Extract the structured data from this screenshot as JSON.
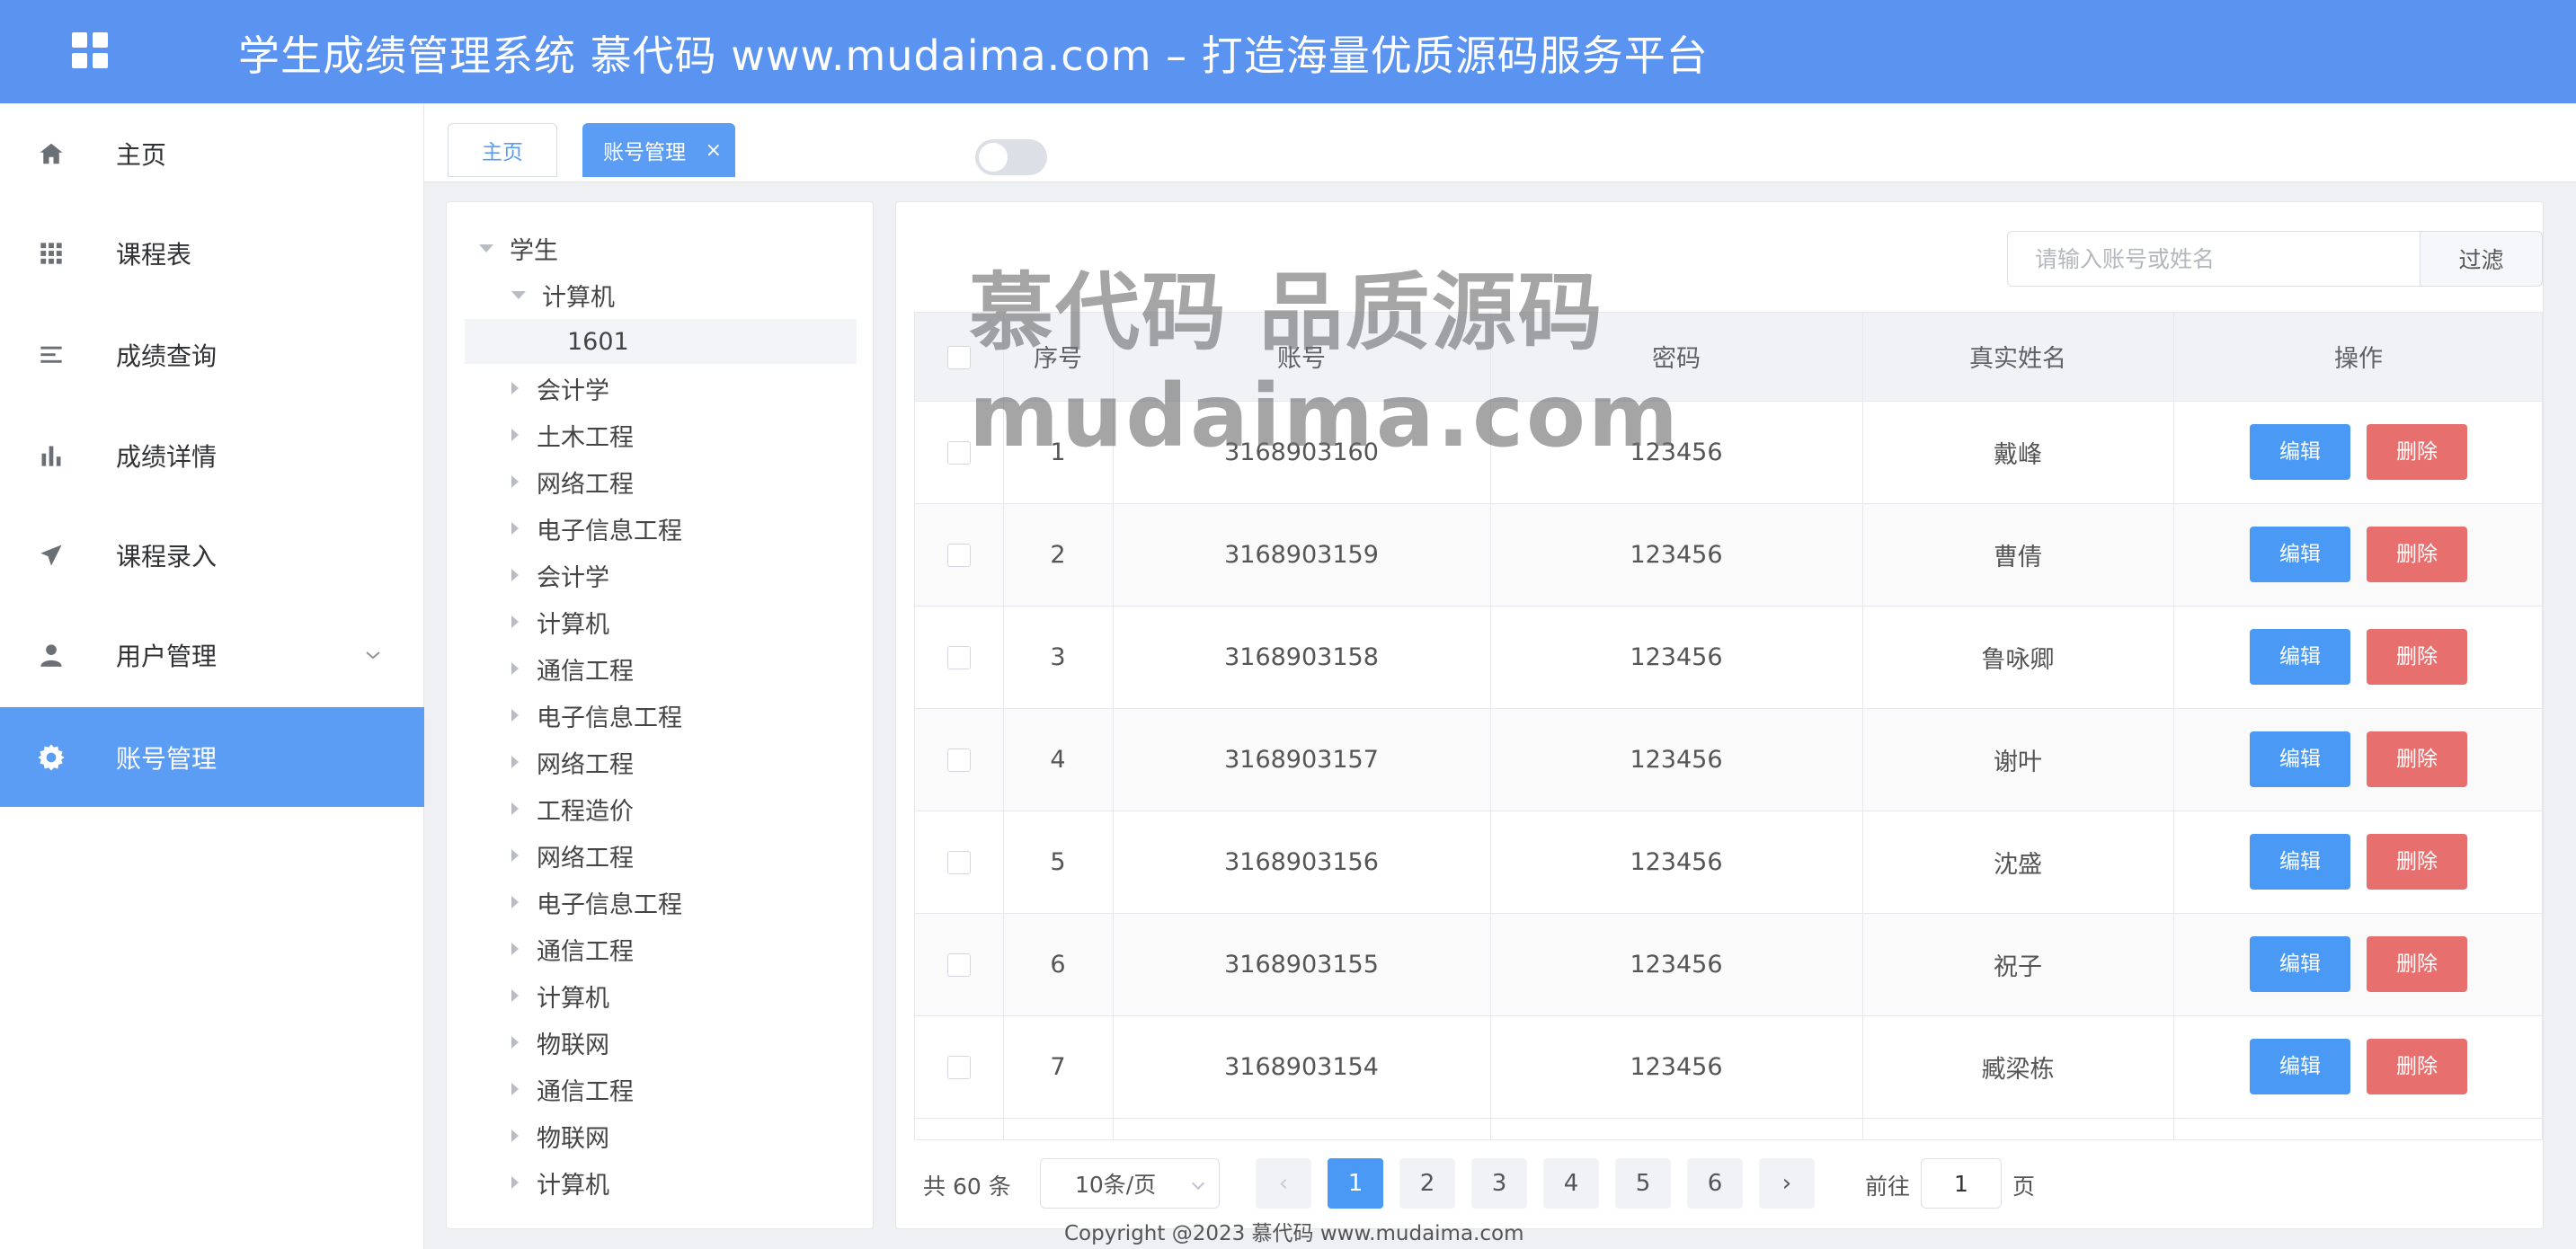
{
  "header": {
    "title": "学生成绩管理系统 慕代码 www.mudaima.com – 打造海量优质源码服务平台"
  },
  "sidebar": {
    "items": [
      {
        "label": "主页",
        "icon": "home-icon"
      },
      {
        "label": "课程表",
        "icon": "grid-icon"
      },
      {
        "label": "成绩查询",
        "icon": "list-icon"
      },
      {
        "label": "成绩详情",
        "icon": "bar-chart-icon"
      },
      {
        "label": "课程录入",
        "icon": "send-icon"
      },
      {
        "label": "用户管理",
        "icon": "user-icon",
        "has_submenu": true
      },
      {
        "label": "账号管理",
        "icon": "gear-icon",
        "active": true
      }
    ]
  },
  "tabs": [
    {
      "label": "主页"
    },
    {
      "label": "账号管理",
      "active": true,
      "close": "×"
    }
  ],
  "tree": {
    "root": "学生",
    "expanded": "计算机",
    "selected_leaf": "1601",
    "nodes": [
      "会计学",
      "土木工程",
      "网络工程",
      "电子信息工程",
      "会计学",
      "计算机",
      "通信工程",
      "电子信息工程",
      "网络工程",
      "工程造价",
      "网络工程",
      "电子信息工程",
      "通信工程",
      "计算机",
      "物联网",
      "通信工程",
      "物联网",
      "计算机"
    ]
  },
  "search": {
    "placeholder": "请输入账号或姓名",
    "filter_label": "过滤"
  },
  "table": {
    "columns": [
      "序号",
      "账号",
      "密码",
      "真实姓名",
      "操作"
    ],
    "edit_label": "编辑",
    "delete_label": "删除",
    "rows": [
      {
        "index": "1",
        "account": "3168903160",
        "password": "123456",
        "name": "戴峰"
      },
      {
        "index": "2",
        "account": "3168903159",
        "password": "123456",
        "name": "曹倩"
      },
      {
        "index": "3",
        "account": "3168903158",
        "password": "123456",
        "name": "鲁咏卿"
      },
      {
        "index": "4",
        "account": "3168903157",
        "password": "123456",
        "name": "谢叶"
      },
      {
        "index": "5",
        "account": "3168903156",
        "password": "123456",
        "name": "沈盛"
      },
      {
        "index": "6",
        "account": "3168903155",
        "password": "123456",
        "name": "祝子"
      },
      {
        "index": "7",
        "account": "3168903154",
        "password": "123456",
        "name": "臧梁栋"
      }
    ]
  },
  "pagination": {
    "total_text": "共 60 条",
    "page_size": "10条/页",
    "pages": [
      "1",
      "2",
      "3",
      "4",
      "5",
      "6"
    ],
    "current_page": "1",
    "prev": "‹",
    "next": "›",
    "goto_label": "前往",
    "goto_value": "1",
    "page_unit": "页"
  },
  "watermark": {
    "line1": "慕代码 品质源码",
    "line2": "mudaima.com"
  },
  "footer": {
    "copyright": "Copyright @2023 慕代码 www.mudaima.com"
  },
  "colors": {
    "header": "#5b93f0",
    "active": "#5b9cf5",
    "edit": "#4a9af5",
    "delete": "#e7706f"
  }
}
